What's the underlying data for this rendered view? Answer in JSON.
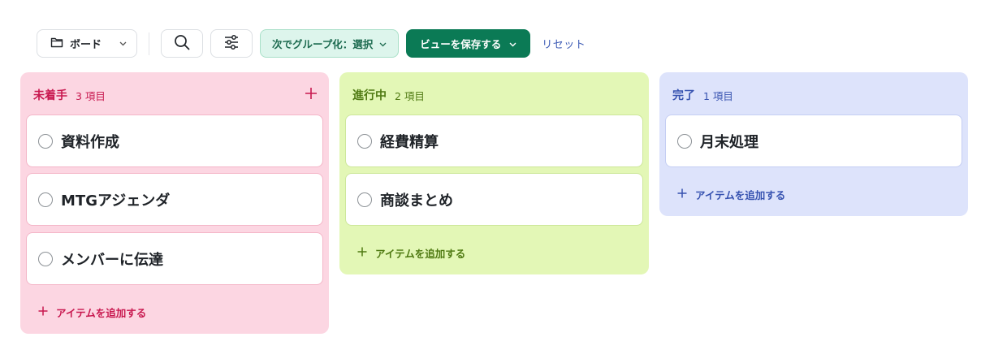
{
  "toolbar": {
    "view_label": "ボード",
    "group_label": "次でグループ化：選択",
    "save_label": "ビューを保存する",
    "reset_label": "リセット"
  },
  "colors": {
    "todo": "#c8184f",
    "in_progress": "#4f7a12",
    "done": "#3652b0",
    "save_button": "#0b7a55"
  },
  "columns": [
    {
      "title": "未着手",
      "count": "3 項目",
      "cards": [
        "資料作成",
        "MTGアジェンダ",
        "メンバーに伝達"
      ],
      "add_label": "アイテムを追加する"
    },
    {
      "title": "進行中",
      "count": "2 項目",
      "cards": [
        "経費精算",
        "商談まとめ"
      ],
      "add_label": "アイテムを追加する"
    },
    {
      "title": "完了",
      "count": "1 項目",
      "cards": [
        "月末処理"
      ],
      "add_label": "アイテムを追加する"
    }
  ]
}
